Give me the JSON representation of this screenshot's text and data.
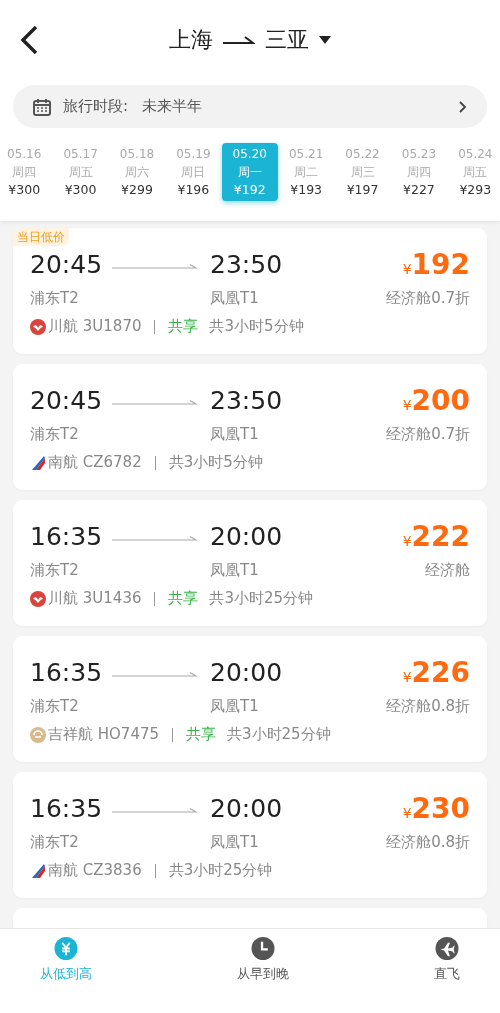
{
  "header": {
    "origin": "上海",
    "destination": "三亚"
  },
  "period": {
    "label": "旅行时段:",
    "value": "未来半年"
  },
  "dates": [
    {
      "date": "05.16",
      "weekday": "周四",
      "price": "¥300",
      "selected": false
    },
    {
      "date": "05.17",
      "weekday": "周五",
      "price": "¥300",
      "selected": false
    },
    {
      "date": "05.18",
      "weekday": "周六",
      "price": "¥299",
      "selected": false
    },
    {
      "date": "05.19",
      "weekday": "周日",
      "price": "¥196",
      "selected": false
    },
    {
      "date": "05.20",
      "weekday": "周一",
      "price": "¥192",
      "selected": true
    },
    {
      "date": "05.21",
      "weekday": "周二",
      "price": "¥193",
      "selected": false
    },
    {
      "date": "05.22",
      "weekday": "周三",
      "price": "¥197",
      "selected": false
    },
    {
      "date": "05.23",
      "weekday": "周四",
      "price": "¥227",
      "selected": false
    },
    {
      "date": "05.24",
      "weekday": "周五",
      "price": "¥293",
      "selected": false
    }
  ],
  "flights": [
    {
      "badge": "当日低价",
      "depart": "20:45",
      "arrive": "23:50",
      "from": "浦东T2",
      "to": "凤凰T1",
      "currency": "¥",
      "price": "192",
      "cabin": "经济舱0.7折",
      "kind": "red",
      "airline": "川航 3U1870",
      "shared": true,
      "shared_label": "共享",
      "duration": "共3小时5分钟"
    },
    {
      "depart": "20:45",
      "arrive": "23:50",
      "from": "浦东T2",
      "to": "凤凰T1",
      "currency": "¥",
      "price": "200",
      "cabin": "经济舱0.7折",
      "kind": "blue",
      "airline": "南航 CZ6782",
      "shared": false,
      "duration": "共3小时5分钟"
    },
    {
      "depart": "16:35",
      "arrive": "20:00",
      "from": "浦东T2",
      "to": "凤凰T1",
      "currency": "¥",
      "price": "222",
      "cabin": "经济舱",
      "kind": "red",
      "airline": "川航 3U1436",
      "shared": true,
      "shared_label": "共享",
      "duration": "共3小时25分钟"
    },
    {
      "depart": "16:35",
      "arrive": "20:00",
      "from": "浦东T2",
      "to": "凤凰T1",
      "currency": "¥",
      "price": "226",
      "cabin": "经济舱0.8折",
      "kind": "tan",
      "airline": "吉祥航 HO7475",
      "shared": true,
      "shared_label": "共享",
      "duration": "共3小时25分钟"
    },
    {
      "depart": "16:35",
      "arrive": "20:00",
      "from": "浦东T2",
      "to": "凤凰T1",
      "currency": "¥",
      "price": "230",
      "cabin": "经济舱0.8折",
      "kind": "blue",
      "airline": "南航 CZ3836",
      "shared": false,
      "duration": "共3小时25分钟"
    },
    {
      "kind": "partial"
    }
  ],
  "sort_tabs": [
    {
      "label": "从低到高",
      "selected": true
    },
    {
      "label": "从早到晚",
      "selected": false
    },
    {
      "label": "直飞",
      "selected": false
    }
  ]
}
